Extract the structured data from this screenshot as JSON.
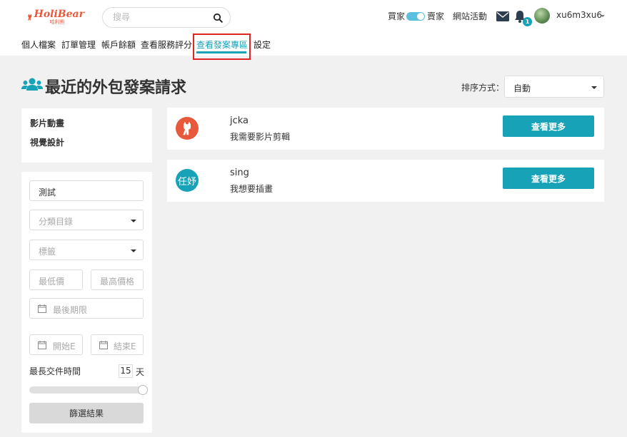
{
  "header": {
    "logo_text": "HoliBear",
    "logo_subtext": "哈利熊",
    "search_placeholder": "搜尋",
    "mode_left": "買家",
    "mode_right": "賣家",
    "site_events": "網站活動",
    "notification_count": "1",
    "username": "xu6m3xu6"
  },
  "nav": {
    "items": [
      "個人檔案",
      "訂單管理",
      "帳戶餘額",
      "查看服務評分",
      "查看發案專區",
      "設定"
    ],
    "active_index": 4
  },
  "page": {
    "title": "最近的外包發案請求",
    "sort_label": "排序方式：",
    "sort_value": "自動"
  },
  "categories": [
    "影片動畫",
    "視覺設計"
  ],
  "filter": {
    "keyword_value": "測試",
    "category_placeholder": "分類目錄",
    "tag_placeholder": "標籤",
    "min_price_placeholder": "最低價",
    "max_price_placeholder": "最高價格",
    "deadline_placeholder": "最後期限",
    "start_placeholder": "開始E",
    "end_placeholder": "結束E",
    "duration_label": "最長交件時間",
    "duration_value": "15",
    "duration_unit": "天",
    "duration_fill": 1.0,
    "submit_label": "篩選結果"
  },
  "requests": [
    {
      "avatar_text": "",
      "avatar_color": "#e8593b",
      "name": "jcka",
      "description": "我需要影片剪輯",
      "button": "查看更多"
    },
    {
      "avatar_text": "任妤",
      "avatar_color": "#17a2b8",
      "name": "sing",
      "description": "我想要插畫",
      "button": "查看更多"
    }
  ],
  "colors": {
    "accent": "#17a2b8",
    "brand": "#e8593b",
    "highlight": "#e02424"
  }
}
